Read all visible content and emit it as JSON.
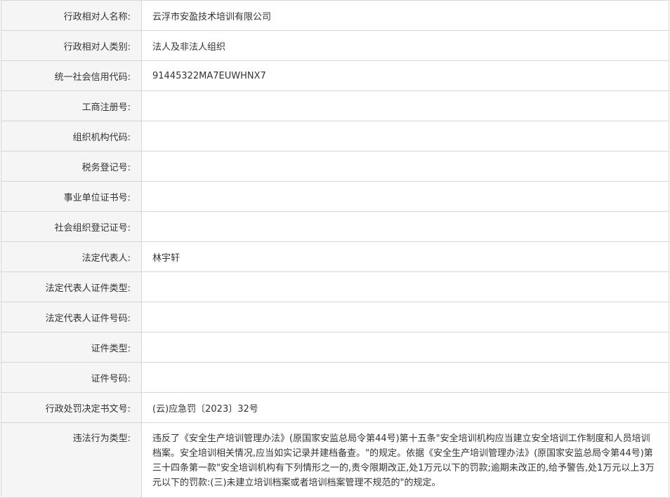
{
  "rows": [
    {
      "label": "行政相对人名称:",
      "value": "云浮市安盈技术培训有限公司"
    },
    {
      "label": "行政相对人类别:",
      "value": "法人及非法人组织"
    },
    {
      "label": "统一社会信用代码:",
      "value": "91445322MA7EUWHNX7"
    },
    {
      "label": "工商注册号:",
      "value": ""
    },
    {
      "label": "组织机构代码:",
      "value": ""
    },
    {
      "label": "税务登记号:",
      "value": ""
    },
    {
      "label": "事业单位证书号:",
      "value": ""
    },
    {
      "label": "社会组织登记证号:",
      "value": ""
    },
    {
      "label": "法定代表人:",
      "value": "林宇轩"
    },
    {
      "label": "法定代表人证件类型:",
      "value": ""
    },
    {
      "label": "法定代表人证件号码:",
      "value": ""
    },
    {
      "label": "证件类型:",
      "value": ""
    },
    {
      "label": "证件号码:",
      "value": ""
    },
    {
      "label": "行政处罚决定书文号:",
      "value": "(云)应急罚〔2023〕32号"
    },
    {
      "label": "违法行为类型:",
      "value": "违反了《安全生产培训管理办法》(原国家安监总局令第44号)第十五条\"安全培训机构应当建立安全培训工作制度和人员培训档案。安全培训相关情况,应当如实记录并建档备查。\"的规定。依据《安全生产培训管理办法》(原国家安监总局令第44号)第三十四条第一款\"安全培训机构有下列情形之一的,责令限期改正,处1万元以下的罚款;逾期未改正的,给予警告,处1万元以上3万元以下的罚款:(三)未建立培训档案或者培训档案管理不规范的\"的规定。"
    }
  ]
}
